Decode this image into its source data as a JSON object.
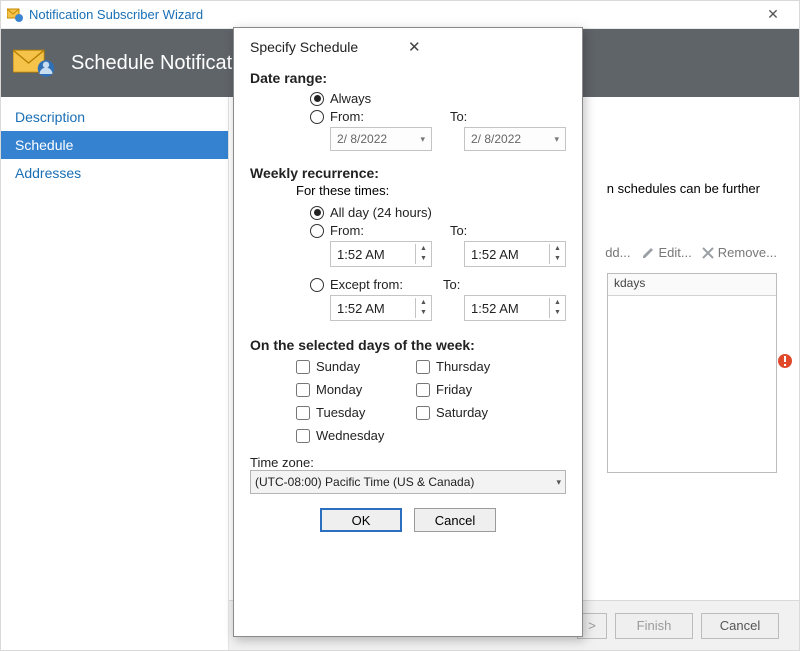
{
  "window": {
    "title": "Notification Subscriber Wizard"
  },
  "header": {
    "title": "Schedule Notificati"
  },
  "sidebar": {
    "items": [
      "Description",
      "Schedule",
      "Addresses"
    ],
    "selected_index": 1
  },
  "main": {
    "desc_fragment": "n schedules can be further",
    "toolbar": {
      "add": "dd...",
      "edit": "Edit...",
      "remove": "Remove..."
    },
    "list": {
      "header": "kdays"
    }
  },
  "footer": {
    "next_fragment": ">",
    "finish": "Finish",
    "cancel": "Cancel"
  },
  "dialog": {
    "title": "Specify Schedule",
    "date_range": {
      "label": "Date range:",
      "always": "Always",
      "from": "From:",
      "to": "To:",
      "from_date": "2/  8/2022",
      "to_date": "2/  8/2022",
      "selected": "always"
    },
    "weekly": {
      "label": "Weekly recurrence:",
      "for_times": "For these times:",
      "all_day": "All day (24 hours)",
      "from": "From:",
      "to": "To:",
      "except": "Except from:",
      "from_time": "1:52 AM",
      "to_time": "1:52 AM",
      "except_from_time": "1:52 AM",
      "except_to_time": "1:52 AM",
      "selected": "all_day"
    },
    "days": {
      "label": "On the selected days of the week:",
      "sunday": "Sunday",
      "monday": "Monday",
      "tuesday": "Tuesday",
      "wednesday": "Wednesday",
      "thursday": "Thursday",
      "friday": "Friday",
      "saturday": "Saturday"
    },
    "timezone": {
      "label": "Time zone:",
      "value": "(UTC-08:00) Pacific Time (US & Canada)"
    },
    "buttons": {
      "ok": "OK",
      "cancel": "Cancel"
    }
  }
}
